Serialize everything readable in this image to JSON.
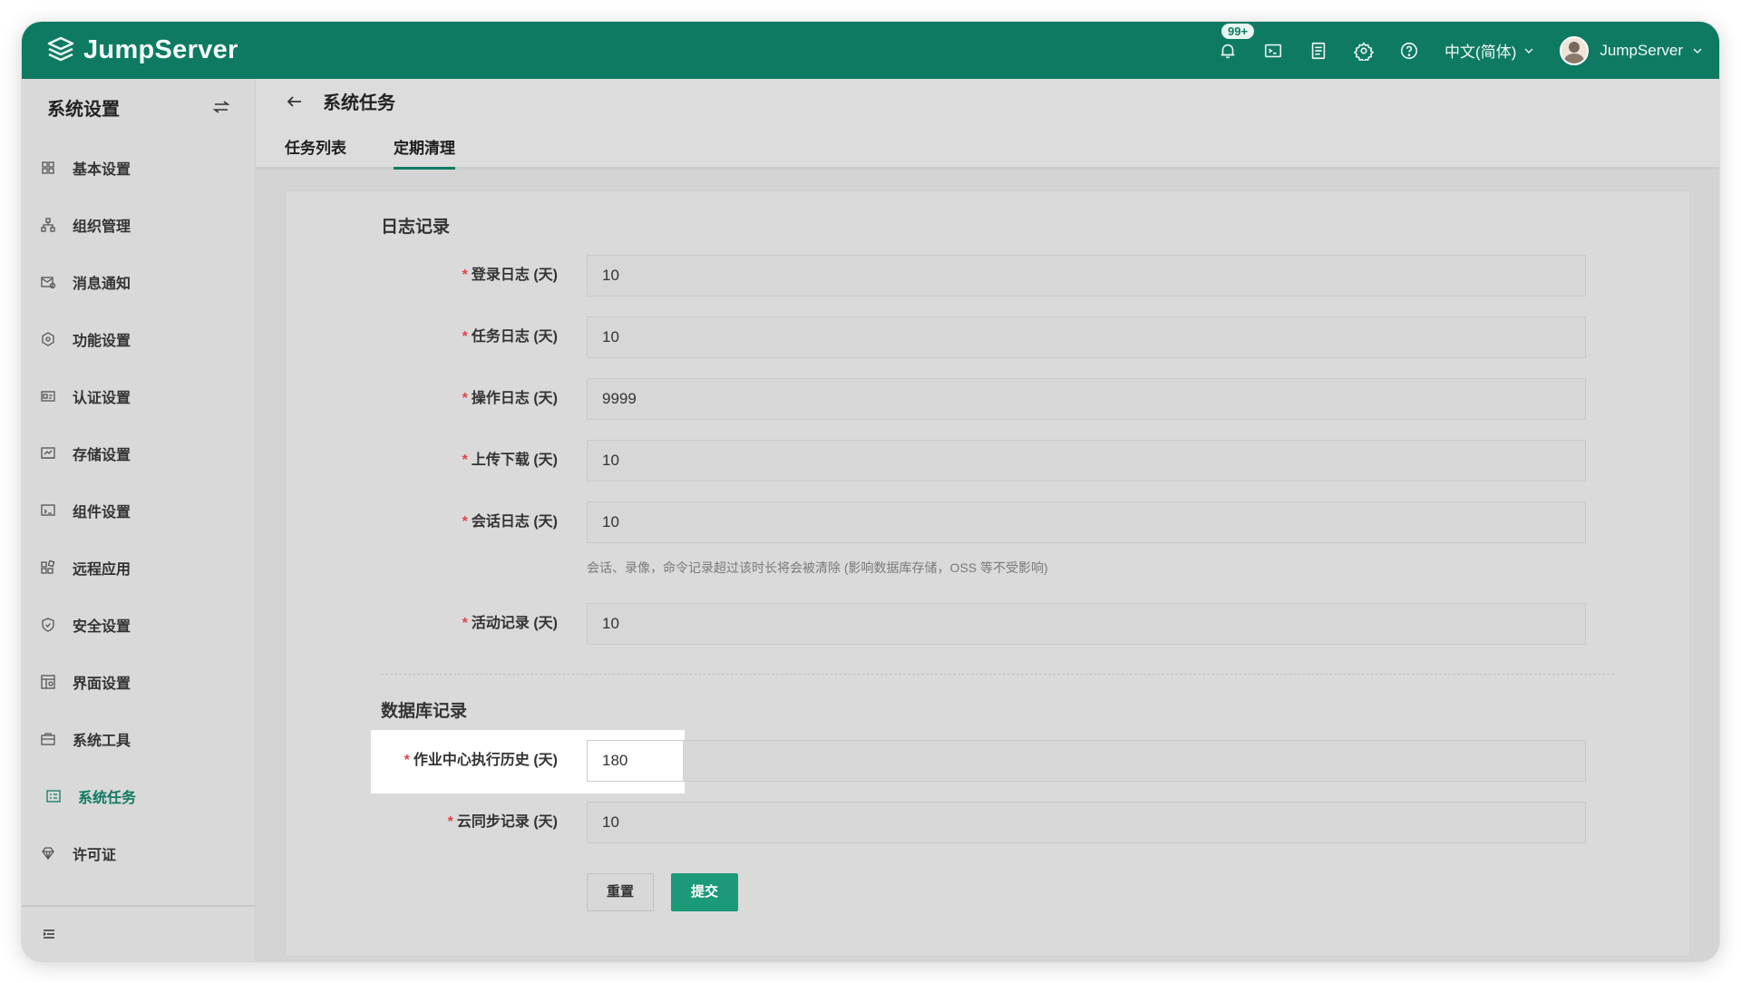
{
  "brand": {
    "name": "JumpServer"
  },
  "topbar": {
    "notification_badge": "99+",
    "language": "中文(简体)",
    "username": "JumpServer"
  },
  "sidebar": {
    "title": "系统设置",
    "items": [
      {
        "label": "基本设置",
        "icon": "grid-icon"
      },
      {
        "label": "组织管理",
        "icon": "org-chart-icon"
      },
      {
        "label": "消息通知",
        "icon": "message-icon"
      },
      {
        "label": "功能设置",
        "icon": "feature-icon"
      },
      {
        "label": "认证设置",
        "icon": "id-card-icon"
      },
      {
        "label": "存储设置",
        "icon": "storage-icon"
      },
      {
        "label": "组件设置",
        "icon": "component-icon"
      },
      {
        "label": "远程应用",
        "icon": "apps-icon"
      },
      {
        "label": "安全设置",
        "icon": "shield-icon"
      },
      {
        "label": "界面设置",
        "icon": "layout-icon"
      },
      {
        "label": "系统工具",
        "icon": "toolbox-icon"
      },
      {
        "label": "系统任务",
        "icon": "task-icon",
        "active": true
      },
      {
        "label": "许可证",
        "icon": "license-icon"
      }
    ]
  },
  "page": {
    "title": "系统任务",
    "tabs": [
      {
        "label": "任务列表",
        "active": false
      },
      {
        "label": "定期清理",
        "active": true
      }
    ]
  },
  "form": {
    "section_log": "日志记录",
    "section_db": "数据库记录",
    "fields": {
      "login_log": {
        "label": "登录日志 (天)",
        "value": "10"
      },
      "task_log": {
        "label": "任务日志 (天)",
        "value": "10"
      },
      "operate_log": {
        "label": "操作日志 (天)",
        "value": "9999"
      },
      "ftp_log": {
        "label": "上传下载 (天)",
        "value": "10"
      },
      "session_log": {
        "label": "会话日志 (天)",
        "value": "10",
        "help": "会话、录像，命令记录超过该时长将会被清除 (影响数据库存储，OSS 等不受影响)"
      },
      "activity_log": {
        "label": "活动记录 (天)",
        "value": "10"
      },
      "job_history": {
        "label": "作业中心执行历史 (天)",
        "value": "180"
      },
      "cloud_sync": {
        "label": "云同步记录 (天)",
        "value": "10"
      }
    },
    "required_mark": "*",
    "reset_label": "重置",
    "submit_label": "提交"
  },
  "colors": {
    "brand": "#0f7a62",
    "submit": "#1a9a78",
    "required": "#e0464a"
  }
}
